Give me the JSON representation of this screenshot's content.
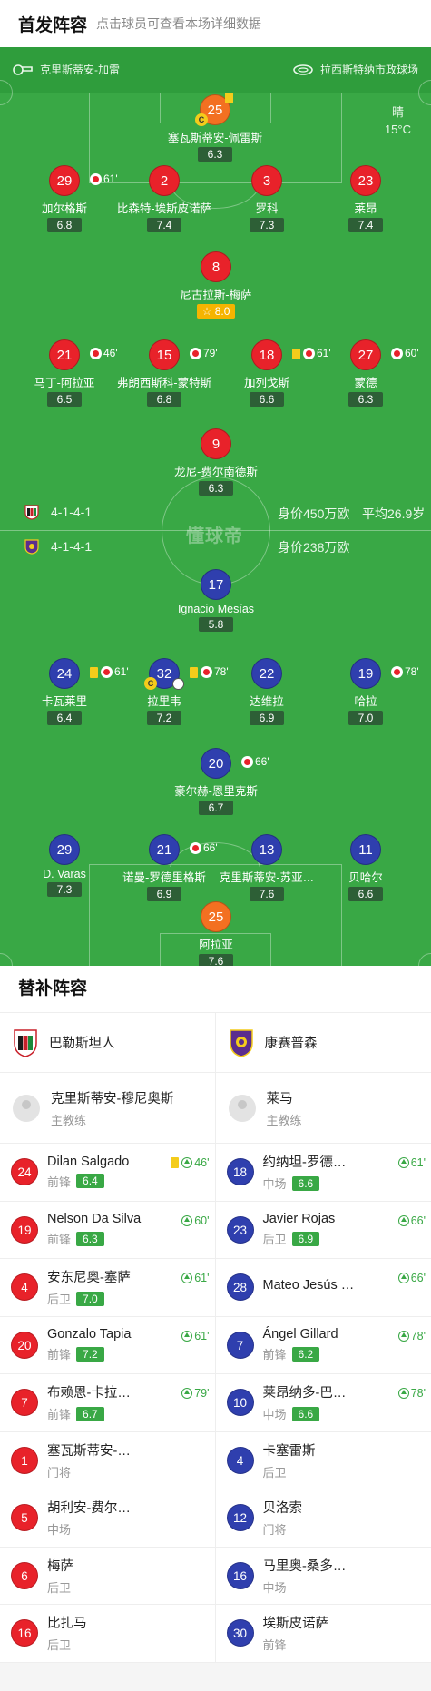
{
  "header": {
    "title": "首发阵容",
    "subtitle": "点击球员可查看本场详细数据"
  },
  "pitch": {
    "coach_left": "克里斯蒂安-加雷",
    "stadium": "拉西斯特纳市政球场",
    "weather": "晴",
    "temperature": "15°C",
    "watermark": "懂球帝",
    "home": {
      "formation": "4-1-4-1",
      "value": "身价450万欧",
      "avg_age": "平均26.9岁"
    },
    "away": {
      "formation": "4-1-4-1",
      "value": "身价238万欧"
    }
  },
  "home_players": [
    {
      "num": "25",
      "name": "塞瓦斯蒂安-佩雷斯",
      "rating": "6.3"
    },
    {
      "num": "29",
      "name": "加尔格斯",
      "rating": "6.8",
      "sub": "61'"
    },
    {
      "num": "2",
      "name": "比森特-埃斯皮诺萨",
      "rating": "7.4"
    },
    {
      "num": "3",
      "name": "罗科",
      "rating": "7.3"
    },
    {
      "num": "23",
      "name": "莱昂",
      "rating": "7.4"
    },
    {
      "num": "8",
      "name": "尼古拉斯-梅萨",
      "rating": "8.0"
    },
    {
      "num": "21",
      "name": "马丁-阿拉亚",
      "rating": "6.5",
      "sub": "46'"
    },
    {
      "num": "15",
      "name": "弗朗西斯科-蒙特斯",
      "rating": "6.8",
      "sub": "79'"
    },
    {
      "num": "18",
      "name": "加列戈斯",
      "rating": "6.6",
      "sub": "61'"
    },
    {
      "num": "27",
      "name": "蒙德",
      "rating": "6.3",
      "sub": "60'"
    },
    {
      "num": "9",
      "name": "龙尼-费尔南德斯",
      "rating": "6.3"
    }
  ],
  "away_players": [
    {
      "num": "17",
      "name": "Ignacio Mesías",
      "rating": "5.8"
    },
    {
      "num": "24",
      "name": "卡瓦莱里",
      "rating": "6.4",
      "sub": "61'"
    },
    {
      "num": "32",
      "name": "拉里韦",
      "rating": "7.2",
      "sub": "78'"
    },
    {
      "num": "22",
      "name": "达维拉",
      "rating": "6.9"
    },
    {
      "num": "19",
      "name": "哈拉",
      "rating": "7.0",
      "sub": "78'"
    },
    {
      "num": "20",
      "name": "豪尔赫-恩里克斯",
      "rating": "6.7",
      "sub": "66'"
    },
    {
      "num": "29",
      "name": "D. Varas",
      "rating": "7.3"
    },
    {
      "num": "21",
      "name": "诺曼-罗德里格斯",
      "rating": "6.9",
      "sub": "66'"
    },
    {
      "num": "13",
      "name": "克里斯蒂安-苏亚…",
      "rating": "7.6"
    },
    {
      "num": "11",
      "name": "贝哈尔",
      "rating": "6.6"
    },
    {
      "num": "25",
      "name": "阿拉亚",
      "rating": "7.6"
    }
  ],
  "subs": {
    "title": "替补阵容",
    "left": {
      "team": "巴勒斯坦人",
      "coach": "克里斯蒂安-穆尼奥斯",
      "coach_role": "主教练",
      "players": [
        {
          "num": "24",
          "name": "Dilan Salgado",
          "pos": "前锋",
          "rating": "6.4",
          "min": "46'",
          "card": true
        },
        {
          "num": "19",
          "name": "Nelson Da Silva",
          "pos": "前锋",
          "rating": "6.3",
          "min": "60'"
        },
        {
          "num": "4",
          "name": "安东尼奥-塞萨",
          "pos": "后卫",
          "rating": "7.0",
          "min": "61'"
        },
        {
          "num": "20",
          "name": "Gonzalo Tapia",
          "pos": "前锋",
          "rating": "7.2",
          "min": "61'"
        },
        {
          "num": "7",
          "name": "布赖恩-卡拉…",
          "pos": "前锋",
          "rating": "6.7",
          "min": "79'"
        },
        {
          "num": "1",
          "name": "塞瓦斯蒂安-…",
          "pos": "门将"
        },
        {
          "num": "5",
          "name": "胡利安-费尔…",
          "pos": "中场"
        },
        {
          "num": "6",
          "name": "梅萨",
          "pos": "后卫"
        },
        {
          "num": "16",
          "name": "比扎马",
          "pos": "后卫"
        }
      ]
    },
    "right": {
      "team": "康赛普森",
      "coach": "莱马",
      "coach_role": "主教练",
      "players": [
        {
          "num": "18",
          "name": "约纳坦-罗德…",
          "pos": "中场",
          "rating": "6.6",
          "min": "61'"
        },
        {
          "num": "23",
          "name": "Javier Rojas",
          "pos": "后卫",
          "rating": "6.9",
          "min": "66'"
        },
        {
          "num": "28",
          "name": "Mateo Jesús …",
          "pos": "",
          "min": "66'"
        },
        {
          "num": "7",
          "name": "Ángel Gillard",
          "pos": "前锋",
          "rating": "6.2",
          "min": "78'"
        },
        {
          "num": "10",
          "name": "莱昂纳多-巴…",
          "pos": "中场",
          "rating": "6.6",
          "min": "78'"
        },
        {
          "num": "4",
          "name": "卡塞雷斯",
          "pos": "后卫"
        },
        {
          "num": "12",
          "name": "贝洛索",
          "pos": "门将"
        },
        {
          "num": "16",
          "name": "马里奥-桑多…",
          "pos": "中场"
        },
        {
          "num": "30",
          "name": "埃斯皮诺萨",
          "pos": "前锋"
        }
      ]
    }
  },
  "colors": {
    "pitch": "#39a845",
    "home": "#e8222a",
    "away": "#2f3fae",
    "gk": "#f37021",
    "rating_bg": "#2d5f36",
    "best": "#f5b400"
  }
}
